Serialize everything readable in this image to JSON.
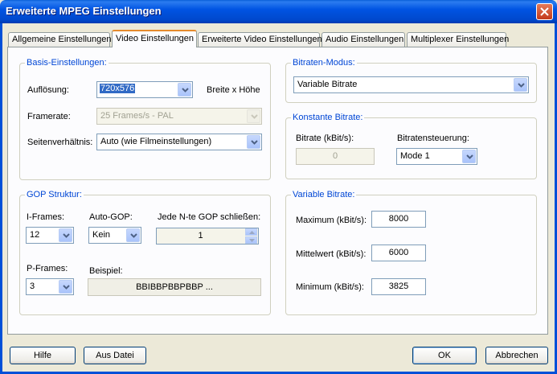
{
  "window": {
    "title": "Erweiterte MPEG Einstellungen",
    "close_icon": "close-icon"
  },
  "tabs": [
    {
      "label": "Allgemeine Einstellungen"
    },
    {
      "label": "Video Einstellungen",
      "active": true
    },
    {
      "label": "Erweiterte Video Einstellungen"
    },
    {
      "label": "Audio Einstellungen"
    },
    {
      "label": "Multiplexer Einstellungen"
    }
  ],
  "basis": {
    "legend": "Basis-Einstellungen:",
    "aufloesung_label": "Auflösung:",
    "aufloesung_value": "720x576",
    "aufloesung_suffix": "Breite x Höhe",
    "framerate_label": "Framerate:",
    "framerate_value": "25 Frames/s - PAL",
    "seiten_label": "Seitenverhältnis:",
    "seiten_value": "Auto (wie Filmeinstellungen)"
  },
  "gop": {
    "legend": "GOP Struktur:",
    "iframes_label": "I-Frames:",
    "iframes_value": "12",
    "autogop_label": "Auto-GOP:",
    "autogop_value": "Kein",
    "close_label": "Jede N-te GOP schließen:",
    "close_value": "1",
    "pframes_label": "P-Frames:",
    "pframes_value": "3",
    "beispiel_label": "Beispiel:",
    "beispiel_value": "BBIBBPBBPBBP ..."
  },
  "bitrate_mode": {
    "legend": "Bitraten-Modus:",
    "value": "Variable Bitrate"
  },
  "konstant": {
    "legend": "Konstante Bitrate:",
    "bitrate_label": "Bitrate (kBit/s):",
    "bitrate_value": "0",
    "steuerung_label": "Bitratensteuerung:",
    "steuerung_value": "Mode 1"
  },
  "variabel": {
    "legend": "Variable Bitrate:",
    "max_label": "Maximum (kBit/s):",
    "max_value": "8000",
    "mittel_label": "Mittelwert (kBit/s):",
    "mittel_value": "6000",
    "min_label": "Minimum (kBit/s):",
    "min_value": "3825"
  },
  "buttons": {
    "help": "Hilfe",
    "from_file": "Aus Datei",
    "ok": "OK",
    "cancel": "Abbrechen"
  }
}
